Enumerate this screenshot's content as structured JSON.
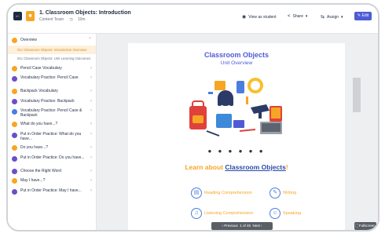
{
  "header": {
    "title": "1. Classroom Objects: Introduction",
    "meta_team": "Content Team",
    "meta_time": "10m",
    "view_as_student": "View as student",
    "share": "Share",
    "assign": "Assign",
    "edit": "Edit"
  },
  "sidebar": {
    "overview": "Overview",
    "overview_sub1": "01c Classroom Objects: Introduction Overview",
    "overview_sub2": "01c Classroom Objects: Unit Learning Outcomes",
    "items": [
      {
        "label": "Pencil Case Vocabulary",
        "color": "#f6a623"
      },
      {
        "label": "Vocabulary Practice: Pencil Case",
        "color": "#6b4fc8"
      },
      {
        "label": "Backpack Vocabulary",
        "color": "#f6a623"
      },
      {
        "label": "Vocabulary Practice: Backpack",
        "color": "#6b4fc8"
      },
      {
        "label": "Vocabulary Practice: Pencil Case & Backpack",
        "color": "#4a7de0"
      },
      {
        "label": "What do you have...?",
        "color": "#f6a623"
      },
      {
        "label": "Put in Order Practice: What do you have...",
        "color": "#6b4fc8"
      },
      {
        "label": "Do you have...?",
        "color": "#f6a623"
      },
      {
        "label": "Put in Order Practice: Do you have...",
        "color": "#6b4fc8"
      },
      {
        "label": "Choose the Right Word",
        "color": "#6b4fc8"
      },
      {
        "label": "May I have...?",
        "color": "#f6a623"
      },
      {
        "label": "Put in Order Practice: May I have...",
        "color": "#6b4fc8"
      }
    ]
  },
  "slide": {
    "title": "Classroom Objects",
    "subtitle": "Unit Overview",
    "learn_prefix": "Learn about ",
    "learn_link": "Classroom Objects",
    "learn_suffix": "!",
    "features": [
      "Reading Comprehension",
      "Writing",
      "Listening Comprehension",
      "Speaking"
    ]
  },
  "pager": {
    "prev": "Previous",
    "count": "1 of 45",
    "next": "Next"
  },
  "fullscreen": "Fullscreen"
}
